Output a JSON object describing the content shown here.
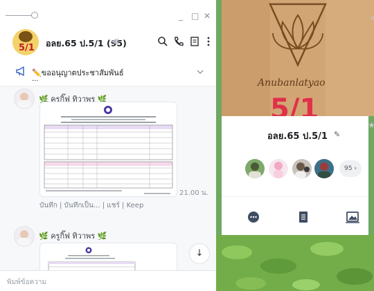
{
  "window": {
    "minimize_glyph": "_",
    "maximize_glyph": "□",
    "close_glyph": "✕"
  },
  "chat": {
    "group_avatar_num": "5/1",
    "group_name": "อลย.65 ป.5/1 (95)",
    "mute_glyph": "◀)",
    "icons": [
      "search-icon",
      "phone-icon",
      "notes-icon",
      "more-icon"
    ],
    "announcement": {
      "text": "✏️ขออนุญาตประชาสัมพันธ์",
      "more": "..."
    },
    "messages": [
      {
        "sender": "ครูกิ๊ฟ ทิวาพร"
      },
      {
        "sender": "ครูกิ๊ฟ ทิวาพร"
      }
    ],
    "leaf_glyph": "🌿",
    "time": "21.00 น.",
    "actions": "บันทึก | บันทึกเป็น... | แชร์ | Keep",
    "scroll_glyph": "↓",
    "input_placeholder": "พิมพ์ข้อความ"
  },
  "profile": {
    "cover_name": "Anubanlatyao",
    "cover_num": "5/1",
    "name": "อลย.65 ป.5/1",
    "edit_glyph": "✎",
    "member_count": "95 ›",
    "close_glyph": "✕",
    "star_glyph": "★"
  },
  "colors": {
    "accent_blue": "#3b66c9",
    "leaf_green": "#5aa83a",
    "cover_red": "#e0304a"
  }
}
